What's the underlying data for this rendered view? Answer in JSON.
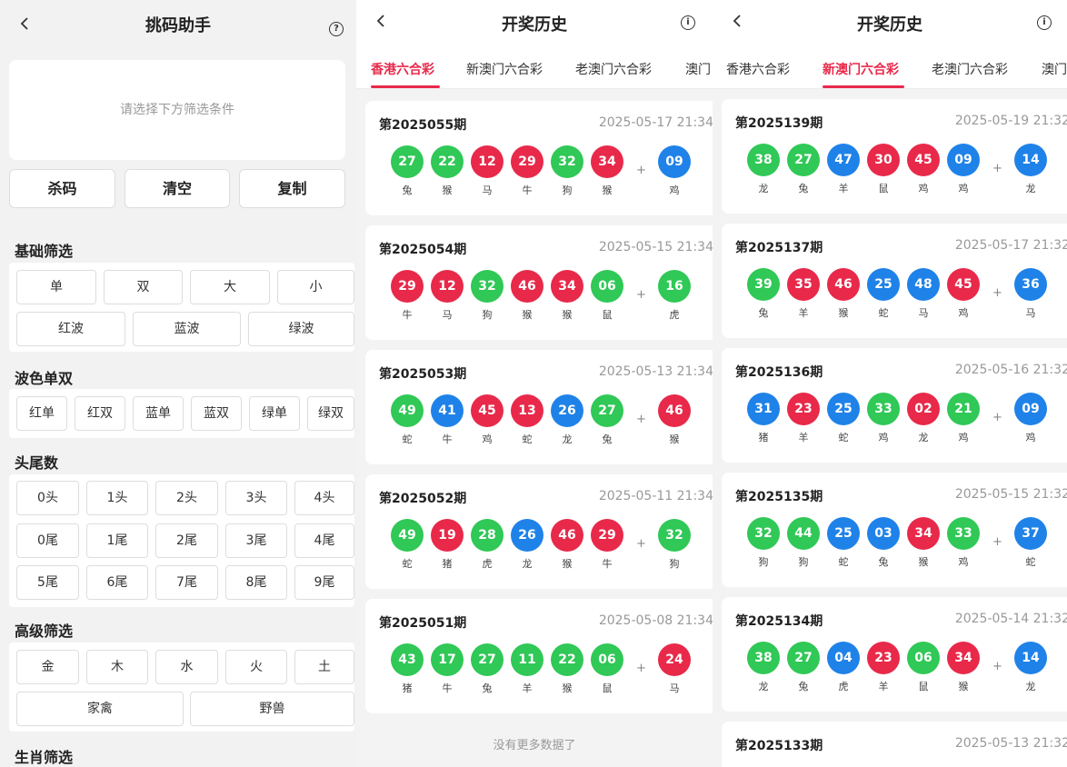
{
  "colors": {
    "red": "#e8294a",
    "blue": "#1f82e8",
    "green": "#30c856",
    "accent": "#e8294a"
  },
  "left": {
    "title": "挑码助手",
    "placeholder": "请选择下方筛选条件",
    "actions": [
      "杀码",
      "清空",
      "复制"
    ],
    "sections": [
      "基础筛选",
      "波色单双",
      "头尾数",
      "高级筛选",
      "生肖筛选"
    ],
    "basic_row1": [
      "单",
      "双",
      "大",
      "小"
    ],
    "basic_row2": [
      "红波",
      "蓝波",
      "绿波"
    ],
    "wave": [
      "红单",
      "红双",
      "蓝单",
      "蓝双",
      "绿单",
      "绿双"
    ],
    "heads": [
      "0头",
      "1头",
      "2头",
      "3头",
      "4头"
    ],
    "tails1": [
      "0尾",
      "1尾",
      "2尾",
      "3尾",
      "4尾"
    ],
    "tails2": [
      "5尾",
      "6尾",
      "7尾",
      "8尾",
      "9尾"
    ],
    "elements": [
      "金",
      "木",
      "水",
      "火",
      "土"
    ],
    "animals": [
      "家禽",
      "野兽"
    ]
  },
  "mid": {
    "title": "开奖历史",
    "tabs": [
      "香港六合彩",
      "新澳门六合彩",
      "老澳门六合彩",
      "澳门"
    ],
    "active_tab": 0,
    "no_more": "没有更多数据了",
    "draws": [
      {
        "issue": "第2025055期",
        "time": "2025-05-17 21:34",
        "balls": [
          {
            "n": "27",
            "z": "兔",
            "c": "green"
          },
          {
            "n": "22",
            "z": "猴",
            "c": "green"
          },
          {
            "n": "12",
            "z": "马",
            "c": "red"
          },
          {
            "n": "29",
            "z": "牛",
            "c": "red"
          },
          {
            "n": "32",
            "z": "狗",
            "c": "green"
          },
          {
            "n": "34",
            "z": "猴",
            "c": "red"
          }
        ],
        "special": {
          "n": "09",
          "z": "鸡",
          "c": "blue"
        }
      },
      {
        "issue": "第2025054期",
        "time": "2025-05-15 21:34",
        "balls": [
          {
            "n": "29",
            "z": "牛",
            "c": "red"
          },
          {
            "n": "12",
            "z": "马",
            "c": "red"
          },
          {
            "n": "32",
            "z": "狗",
            "c": "green"
          },
          {
            "n": "46",
            "z": "猴",
            "c": "red"
          },
          {
            "n": "34",
            "z": "猴",
            "c": "red"
          },
          {
            "n": "06",
            "z": "鼠",
            "c": "green"
          }
        ],
        "special": {
          "n": "16",
          "z": "虎",
          "c": "green"
        }
      },
      {
        "issue": "第2025053期",
        "time": "2025-05-13 21:34",
        "balls": [
          {
            "n": "49",
            "z": "蛇",
            "c": "green"
          },
          {
            "n": "41",
            "z": "牛",
            "c": "blue"
          },
          {
            "n": "45",
            "z": "鸡",
            "c": "red"
          },
          {
            "n": "13",
            "z": "蛇",
            "c": "red"
          },
          {
            "n": "26",
            "z": "龙",
            "c": "blue"
          },
          {
            "n": "27",
            "z": "兔",
            "c": "green"
          }
        ],
        "special": {
          "n": "46",
          "z": "猴",
          "c": "red"
        }
      },
      {
        "issue": "第2025052期",
        "time": "2025-05-11 21:34",
        "balls": [
          {
            "n": "49",
            "z": "蛇",
            "c": "green"
          },
          {
            "n": "19",
            "z": "猪",
            "c": "red"
          },
          {
            "n": "28",
            "z": "虎",
            "c": "green"
          },
          {
            "n": "26",
            "z": "龙",
            "c": "blue"
          },
          {
            "n": "46",
            "z": "猴",
            "c": "red"
          },
          {
            "n": "29",
            "z": "牛",
            "c": "red"
          }
        ],
        "special": {
          "n": "32",
          "z": "狗",
          "c": "green"
        }
      },
      {
        "issue": "第2025051期",
        "time": "2025-05-08 21:34",
        "balls": [
          {
            "n": "43",
            "z": "猪",
            "c": "green"
          },
          {
            "n": "17",
            "z": "牛",
            "c": "green"
          },
          {
            "n": "27",
            "z": "兔",
            "c": "green"
          },
          {
            "n": "11",
            "z": "羊",
            "c": "green"
          },
          {
            "n": "22",
            "z": "猴",
            "c": "green"
          },
          {
            "n": "06",
            "z": "鼠",
            "c": "green"
          }
        ],
        "special": {
          "n": "24",
          "z": "马",
          "c": "red"
        }
      }
    ]
  },
  "right": {
    "title": "开奖历史",
    "tabs": [
      "香港六合彩",
      "新澳门六合彩",
      "老澳门六合彩",
      "澳门"
    ],
    "active_tab": 1,
    "draws": [
      {
        "issue": "第2025139期",
        "time": "2025-05-19 21:32",
        "balls": [
          {
            "n": "38",
            "z": "龙",
            "c": "green"
          },
          {
            "n": "27",
            "z": "兔",
            "c": "green"
          },
          {
            "n": "47",
            "z": "羊",
            "c": "blue"
          },
          {
            "n": "30",
            "z": "鼠",
            "c": "red"
          },
          {
            "n": "45",
            "z": "鸡",
            "c": "red"
          },
          {
            "n": "09",
            "z": "鸡",
            "c": "blue"
          }
        ],
        "special": {
          "n": "14",
          "z": "龙",
          "c": "blue"
        }
      },
      {
        "issue": "第2025137期",
        "time": "2025-05-17 21:32",
        "balls": [
          {
            "n": "39",
            "z": "兔",
            "c": "green"
          },
          {
            "n": "35",
            "z": "羊",
            "c": "red"
          },
          {
            "n": "46",
            "z": "猴",
            "c": "red"
          },
          {
            "n": "25",
            "z": "蛇",
            "c": "blue"
          },
          {
            "n": "48",
            "z": "马",
            "c": "blue"
          },
          {
            "n": "45",
            "z": "鸡",
            "c": "red"
          }
        ],
        "special": {
          "n": "36",
          "z": "马",
          "c": "blue"
        }
      },
      {
        "issue": "第2025136期",
        "time": "2025-05-16 21:32",
        "balls": [
          {
            "n": "31",
            "z": "猪",
            "c": "blue"
          },
          {
            "n": "23",
            "z": "羊",
            "c": "red"
          },
          {
            "n": "25",
            "z": "蛇",
            "c": "blue"
          },
          {
            "n": "33",
            "z": "鸡",
            "c": "green"
          },
          {
            "n": "02",
            "z": "龙",
            "c": "red"
          },
          {
            "n": "21",
            "z": "鸡",
            "c": "green"
          }
        ],
        "special": {
          "n": "09",
          "z": "鸡",
          "c": "blue"
        }
      },
      {
        "issue": "第2025135期",
        "time": "2025-05-15 21:32",
        "balls": [
          {
            "n": "32",
            "z": "狗",
            "c": "green"
          },
          {
            "n": "44",
            "z": "狗",
            "c": "green"
          },
          {
            "n": "25",
            "z": "蛇",
            "c": "blue"
          },
          {
            "n": "03",
            "z": "兔",
            "c": "blue"
          },
          {
            "n": "34",
            "z": "猴",
            "c": "red"
          },
          {
            "n": "33",
            "z": "鸡",
            "c": "green"
          }
        ],
        "special": {
          "n": "37",
          "z": "蛇",
          "c": "blue"
        }
      },
      {
        "issue": "第2025134期",
        "time": "2025-05-14 21:32",
        "balls": [
          {
            "n": "38",
            "z": "龙",
            "c": "green"
          },
          {
            "n": "27",
            "z": "兔",
            "c": "green"
          },
          {
            "n": "04",
            "z": "虎",
            "c": "blue"
          },
          {
            "n": "23",
            "z": "羊",
            "c": "red"
          },
          {
            "n": "06",
            "z": "鼠",
            "c": "green"
          },
          {
            "n": "34",
            "z": "猴",
            "c": "red"
          }
        ],
        "special": {
          "n": "14",
          "z": "龙",
          "c": "blue"
        }
      },
      {
        "issue": "第2025133期",
        "time": "2025-05-13 21:32",
        "balls": [],
        "special": null
      }
    ]
  }
}
